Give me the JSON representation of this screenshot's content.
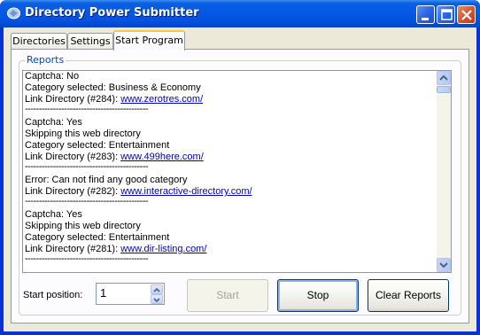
{
  "window": {
    "title": "Directory Power Submitter"
  },
  "tabs": [
    {
      "label": "Directories"
    },
    {
      "label": "Settings"
    },
    {
      "label": "Start Program"
    }
  ],
  "reports": {
    "group_label": "Reports",
    "lines": [
      "Captcha: No",
      "Category selected: Business & Economy",
      "Link Directory (#284): ",
      "Captcha: Yes",
      "Skipping this web directory",
      "Category selected: Entertainment",
      "Link Directory (#283): ",
      "Error: Can not find any good category",
      "Link Directory (#282): ",
      "Captcha: Yes",
      "Skipping this web directory",
      "Category selected: Entertainment",
      "Link Directory (#281): "
    ],
    "links": [
      "www.zerotres.com/",
      "www.499here.com/",
      "www.interactive-directory.com/",
      "www.dir-listing.com/"
    ],
    "separator": "--------------------------------------------"
  },
  "controls": {
    "start_position_label": "Start position:",
    "start_position_value": "1",
    "start_button": "Start",
    "stop_button": "Stop",
    "clear_button": "Clear Reports"
  },
  "colors": {
    "titlebar": "#0558e6",
    "client_bg": "#ece9d8",
    "group_label": "#0046d5",
    "link": "#0000cc",
    "active_tab_accent": "#ffc83c"
  }
}
